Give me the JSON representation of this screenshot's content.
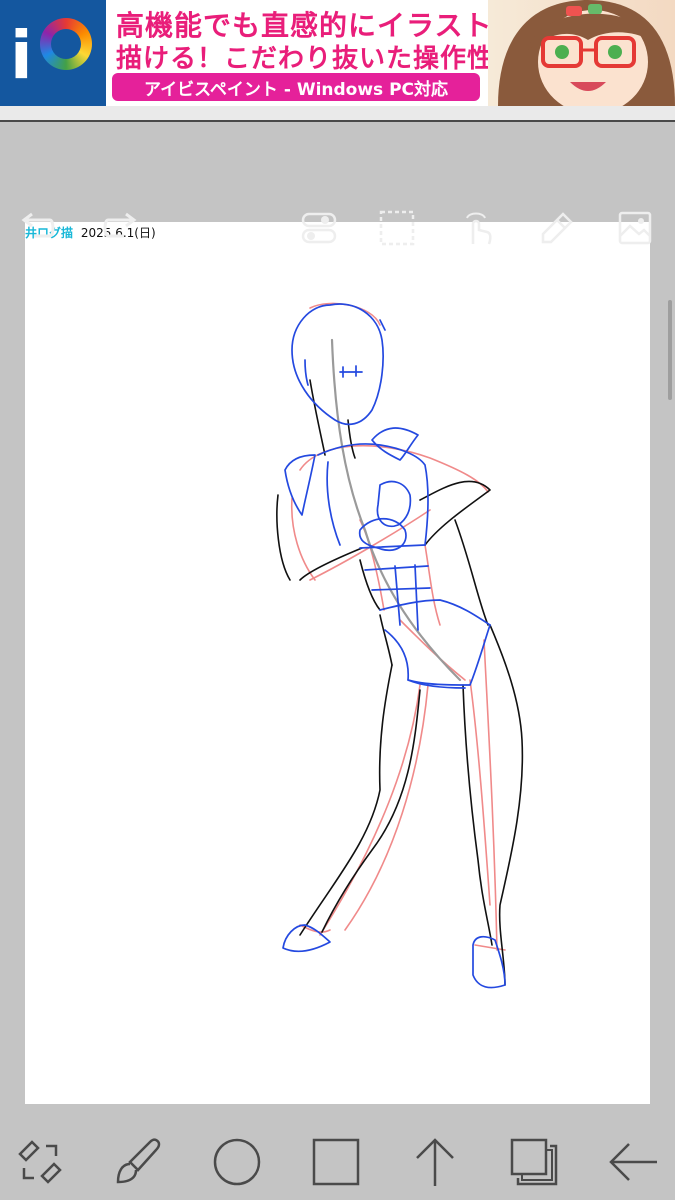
{
  "ad": {
    "line1": "高機能でも直感的にイラストが",
    "line2": "描ける！こだわり抜いた操作性！",
    "pill": "アイビスペイント - Windows PC対応",
    "logo_text": "i",
    "colors": {
      "logo_bg": "#14579f",
      "pill_bg": "#e5219a",
      "headline": "#e91e7a"
    }
  },
  "canvas": {
    "signature_name": "井ログ描",
    "signature_date": "2025.6.1(日)"
  },
  "top_toolbar": {
    "icons": [
      "undo-icon",
      "redo-icon",
      "toggle-icon",
      "selection-icon",
      "touch-icon",
      "eyedropper-icon",
      "image-icon"
    ]
  },
  "bottom_toolbar": {
    "icons": [
      "transform-icon",
      "brush-icon",
      "circle-icon",
      "square-icon",
      "up-arrow-icon",
      "layers-icon",
      "back-arrow-icon"
    ]
  },
  "colors": {
    "workspace": "#c4c4c4",
    "canvas": "#ffffff",
    "sketch_blue": "#2449e0",
    "sketch_red": "#f08a8a",
    "sketch_black": "#111111",
    "signature": "#19b8d8"
  }
}
